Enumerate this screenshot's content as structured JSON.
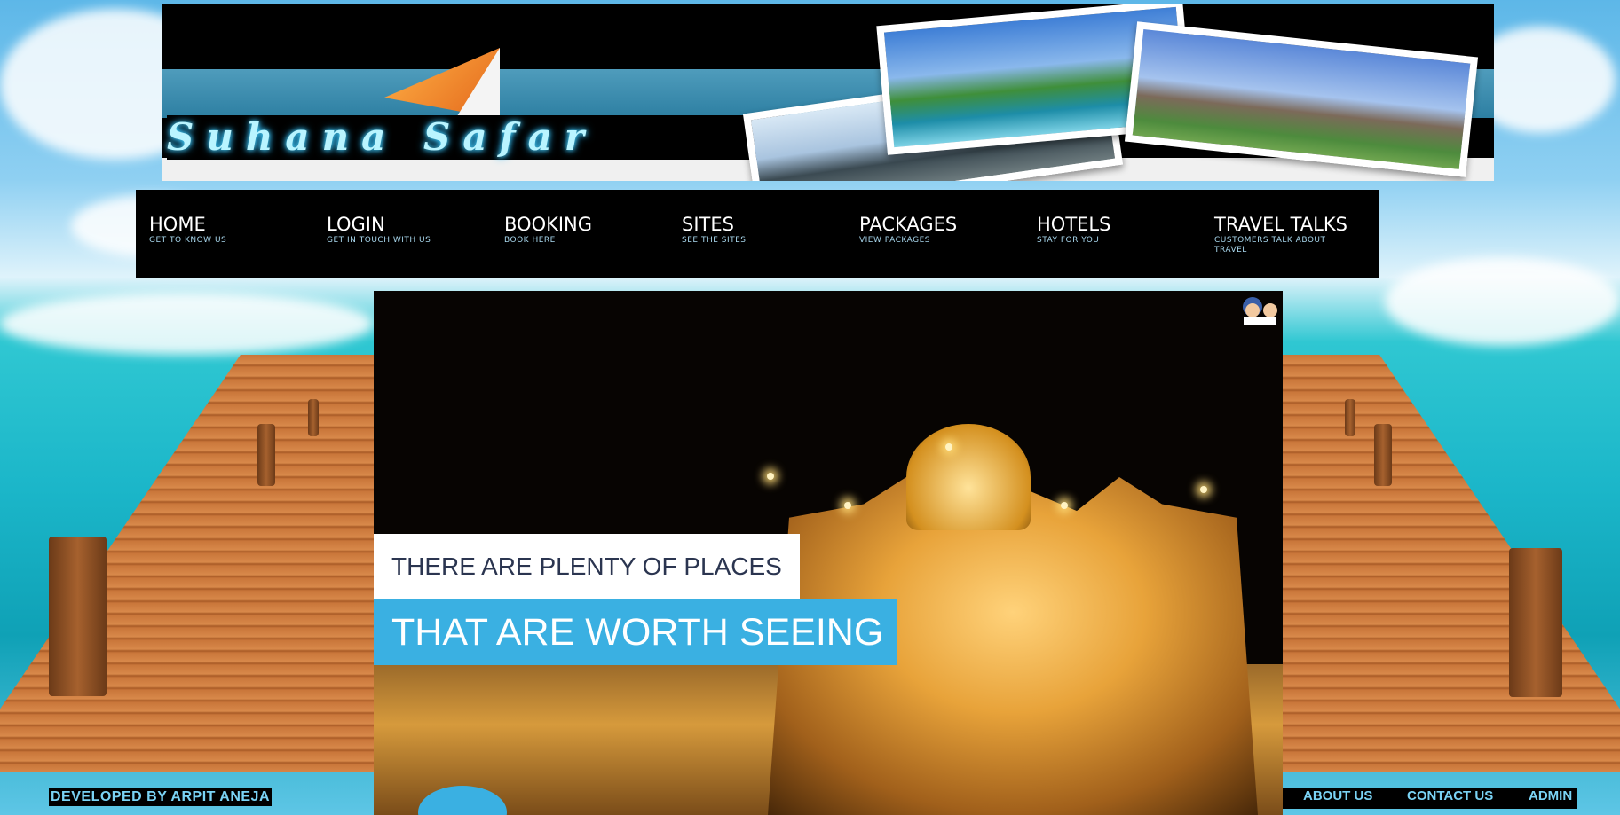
{
  "brand": {
    "logo_text": "Suhana Safar"
  },
  "nav": {
    "items": [
      {
        "title": "HOME",
        "subtitle": "GET TO KNOW US"
      },
      {
        "title": "LOGIN",
        "subtitle": "GET IN TOUCH WITH US"
      },
      {
        "title": "BOOKING",
        "subtitle": "BOOK HERE"
      },
      {
        "title": "SITES",
        "subtitle": "SEE THE SITES"
      },
      {
        "title": "PACKAGES",
        "subtitle": "VIEW PACKAGES"
      },
      {
        "title": "HOTELS",
        "subtitle": "STAY FOR YOU"
      },
      {
        "title": "TRAVEL TALKS",
        "subtitle": "CUSTOMERS TALK ABOUT TRAVEL"
      }
    ]
  },
  "hero": {
    "caption_line1": "THERE ARE PLENTY OF PLACES",
    "caption_line2": "THAT ARE WORTH SEEING"
  },
  "footer": {
    "credit": "DEVELOPED BY ARPIT ANEJA",
    "links": [
      "ABOUT US",
      "CONTACT US",
      "ADMIN"
    ]
  },
  "colors": {
    "nav_bg": "#000000",
    "nav_sub": "#a9d8ee",
    "accent_blue": "#3ab0e2",
    "footer_text": "#7ad3f5"
  },
  "icons": [
    "mascot-icon"
  ]
}
